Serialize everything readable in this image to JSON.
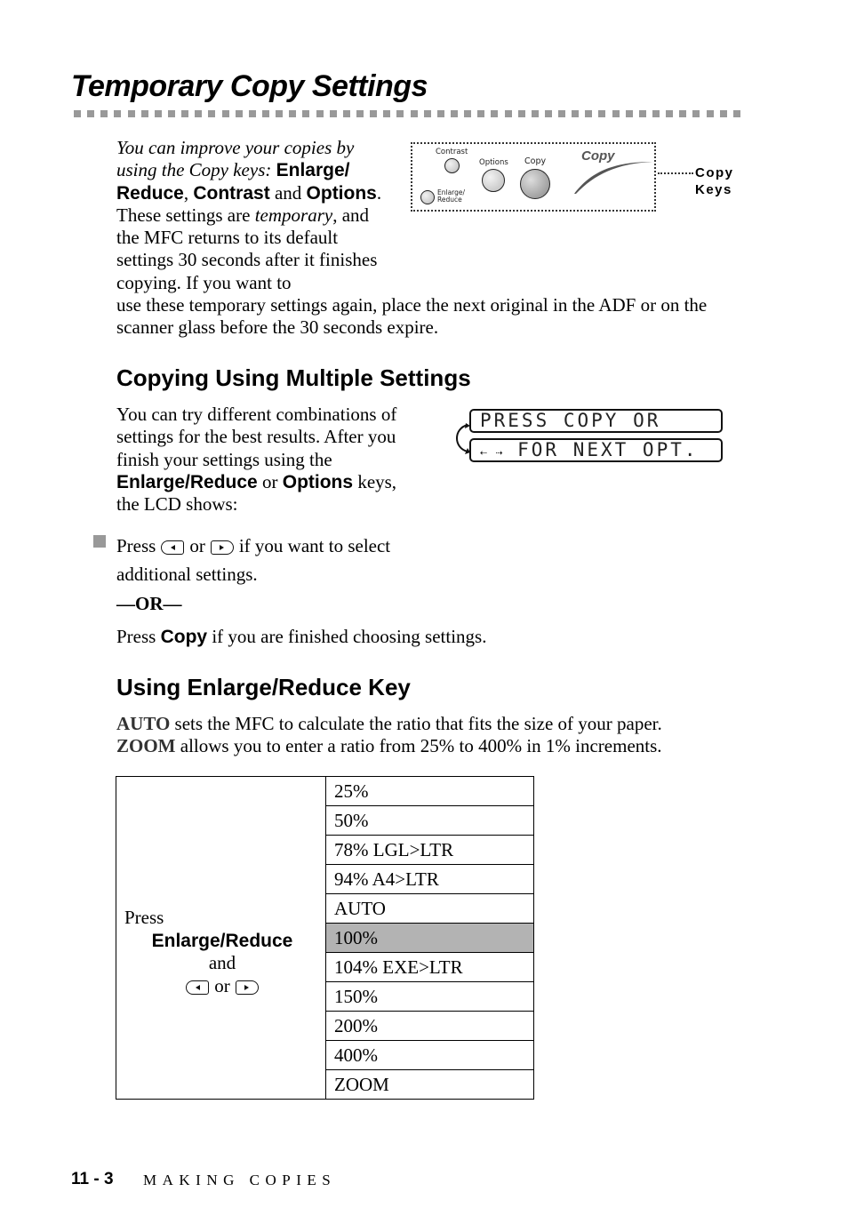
{
  "page": {
    "title": "Temporary Copy Settings",
    "intro": {
      "lead_italic": "You can improve your copies by using the Copy keys:",
      "key1": "Enlarge/ Reduce",
      "key2": "Contrast",
      "and": "and",
      "key3": "Options",
      "sentence2_pre": ". These settings are",
      "temporary": "temporary",
      "sentence2_post": ", and the MFC returns to its default settings 30 seconds after it finishes copying. If you want to use these temporary settings again, place the next original in the ADF or on the scanner glass before the 30 seconds expire."
    },
    "panel": {
      "contrast_label": "Contrast",
      "options_label": "Options",
      "copy_label": "Copy",
      "enlarge_label_1": "Enlarge/",
      "enlarge_label_2": "Reduce",
      "logo_text": "Copy",
      "callout_line1": "Copy",
      "callout_line2": "Keys"
    },
    "section1": {
      "heading": "Copying Using Multiple Settings",
      "para_pre": "You can try different combinations of settings for the best results. After you finish your settings using the",
      "key_a": "Enlarge/Reduce",
      "or": "or",
      "key_b": "Options",
      "para_post": "keys, the LCD shows:",
      "lcd_line1": "PRESS COPY OR",
      "lcd_line2_arrows": "⇠ ⇢",
      "lcd_line2_text": "FOR NEXT OPT.",
      "bullet_press": "Press",
      "bullet_or": "or",
      "bullet_post": "if you want to select additional settings.",
      "or_separator": "—OR—",
      "press_copy_pre": "Press",
      "press_copy_key": "Copy",
      "press_copy_post": "if you are finished choosing settings."
    },
    "section2": {
      "heading": "Using Enlarge/Reduce Key",
      "auto_term": "AUTO",
      "auto_desc": "sets the MFC to calculate the ratio that fits the size of your paper.",
      "zoom_term": "ZOOM",
      "zoom_desc": "allows you to enter a ratio from 25% to 400% in 1% increments.",
      "table": {
        "left_press": "Press",
        "left_key": "Enlarge/Reduce",
        "left_and": "and",
        "left_or": "or",
        "options": [
          "25%",
          "50%",
          "78% LGL>LTR",
          "94% A4>LTR",
          "AUTO",
          "100%",
          "104% EXE>LTR",
          "150%",
          "200%",
          "400%",
          "ZOOM"
        ],
        "highlighted": "100%",
        "highlight_color": "#b3b3b3"
      }
    },
    "footer": {
      "page_number": "11 - 3",
      "chapter": "MAKING COPIES"
    }
  }
}
